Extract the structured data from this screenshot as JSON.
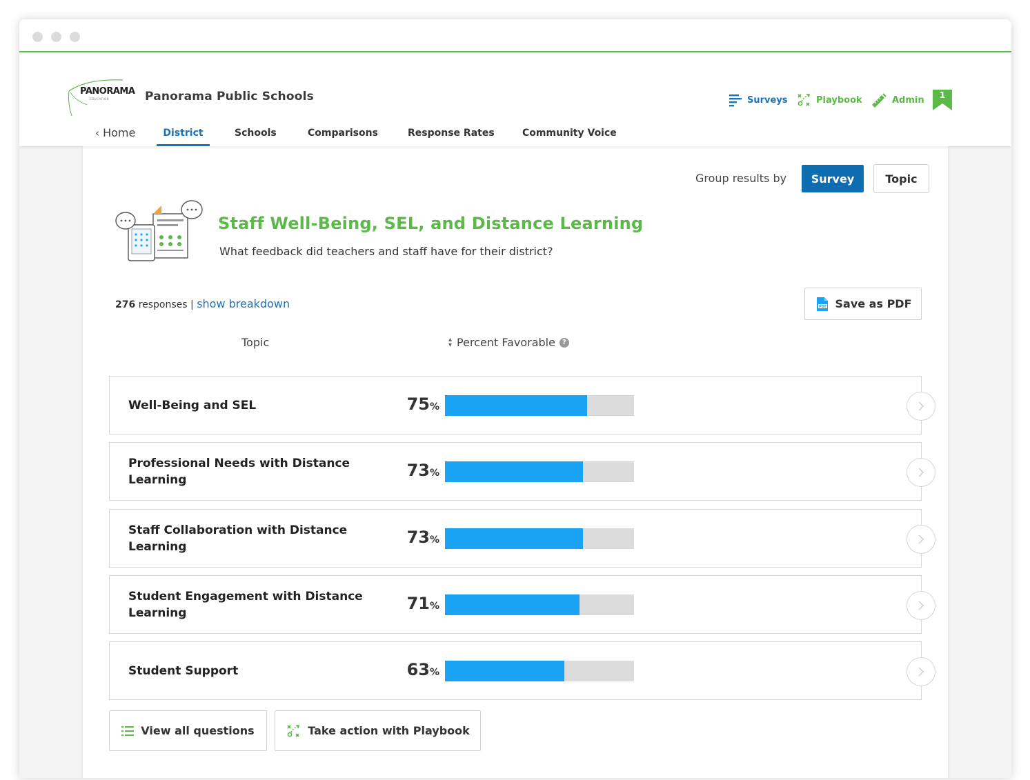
{
  "org": {
    "logo_text": "PANORAMA",
    "logo_sub": "EDUCATION",
    "name": "Panorama Public Schools"
  },
  "topnav": {
    "surveys": "Surveys",
    "playbook": "Playbook",
    "admin": "Admin",
    "bookmark_count": "1"
  },
  "tabs": {
    "home": "Home",
    "district": "District",
    "schools": "Schools",
    "comparisons": "Comparisons",
    "response_rates": "Response Rates",
    "community_voice": "Community Voice"
  },
  "group": {
    "label": "Group results by",
    "survey": "Survey",
    "topic": "Topic"
  },
  "survey": {
    "title": "Staff Well-Being, SEL, and Distance Learning",
    "subtitle": "What feedback did teachers and staff have for their district?"
  },
  "responses": {
    "count": "276",
    "label": "responses",
    "separator": "|",
    "breakdown": "show breakdown"
  },
  "save_pdf": "Save as PDF",
  "columns": {
    "topic": "Topic",
    "percent": "Percent Favorable",
    "help": "?"
  },
  "percent_sign": "%",
  "colors": {
    "accent_green": "#5cb848",
    "brand_blue": "#0e6cb0",
    "bar_fill": "#1aa3f5",
    "bar_track": "#dcdcdc"
  },
  "topics": [
    {
      "label": "Well-Being and SEL",
      "percent": 75
    },
    {
      "label": "Professional Needs with Distance Learning",
      "percent": 73
    },
    {
      "label": "Staff Collaboration with Distance Learning",
      "percent": 73
    },
    {
      "label": "Student Engagement with Distance Learning",
      "percent": 71
    },
    {
      "label": "Student Support",
      "percent": 63
    }
  ],
  "actions": {
    "view_questions": "View all questions",
    "playbook": "Take action with Playbook"
  }
}
